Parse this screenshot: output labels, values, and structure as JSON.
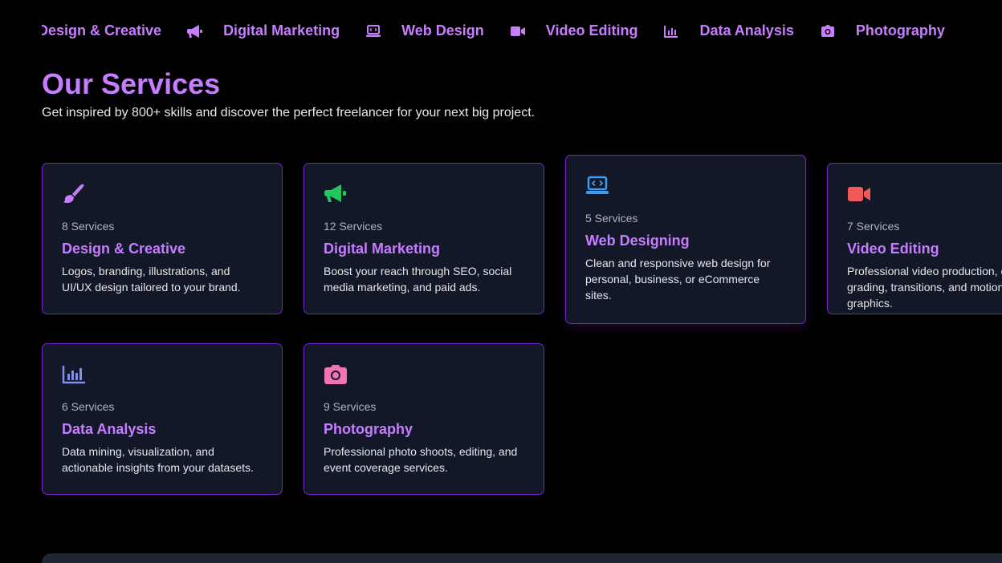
{
  "marquee": {
    "items": [
      {
        "icon": "paintbrush-icon",
        "label": "Design & Creative"
      },
      {
        "icon": "megaphone-icon",
        "label": "Digital Marketing"
      },
      {
        "icon": "laptop-code-icon",
        "label": "Web Design"
      },
      {
        "icon": "video-camera-icon",
        "label": "Video Editing"
      },
      {
        "icon": "bar-chart-icon",
        "label": "Data Analysis"
      },
      {
        "icon": "camera-icon",
        "label": "Photography"
      }
    ]
  },
  "section": {
    "title": "Our Services",
    "subtitle": "Get inspired by 800+ skills and discover the perfect freelancer for your next big project."
  },
  "cards": [
    {
      "icon": "paintbrush-icon",
      "icon_color": "#c77dff",
      "count": "8 Services",
      "title": "Design & Creative",
      "desc": "Logos, branding, illustrations, and UI/UX design tailored to your brand."
    },
    {
      "icon": "megaphone-icon",
      "icon_color": "#22c55e",
      "count": "12 Services",
      "title": "Digital Marketing",
      "desc": "Boost your reach through SEO, social media marketing, and paid ads."
    },
    {
      "icon": "laptop-code-icon",
      "icon_color": "#3b9cf6",
      "count": "5 Services",
      "title": "Web Designing",
      "desc": "Clean and responsive web design for personal, business, or eCommerce sites."
    },
    {
      "icon": "video-camera-icon",
      "icon_color": "#f25a5a",
      "count": "7 Services",
      "title": "Video Editing",
      "desc": "Professional video production, color grading, transitions, and motion graphics."
    },
    {
      "icon": "bar-chart-icon",
      "icon_color": "#818cf8",
      "count": "6 Services",
      "title": "Data Analysis",
      "desc": "Data mining, visualization, and actionable insights from your datasets."
    },
    {
      "icon": "camera-icon",
      "icon_color": "#f472b6",
      "count": "9 Services",
      "title": "Photography",
      "desc": "Professional photo shoots, editing, and event coverage services."
    }
  ],
  "colors": {
    "accent": "#c77dff",
    "card_bg": "#121827",
    "card_border": "#7a22c9",
    "page_bg": "#000000"
  }
}
